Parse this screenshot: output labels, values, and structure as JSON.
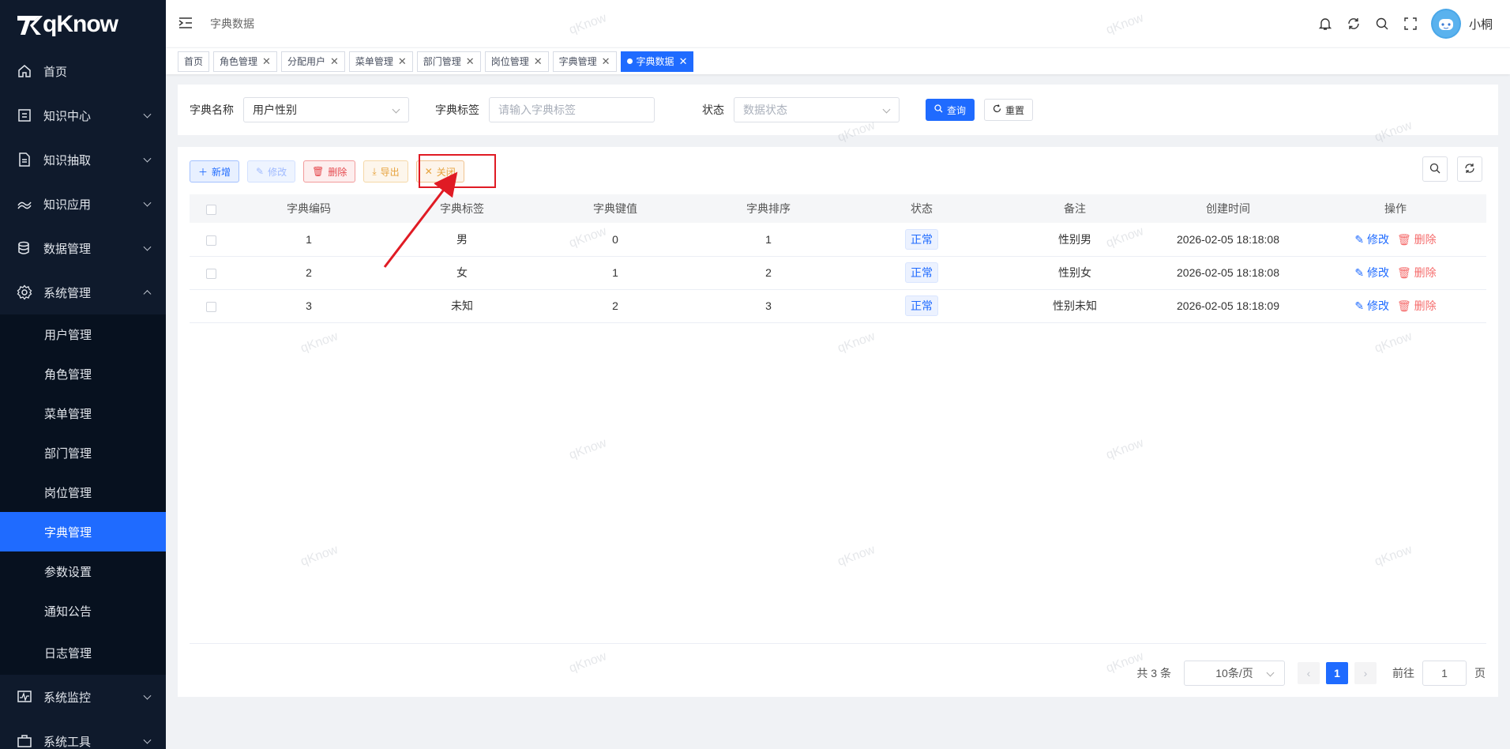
{
  "logo": {
    "text": "qKnow"
  },
  "sidebar": {
    "items": [
      {
        "label": "首页",
        "icon": "home-icon"
      },
      {
        "label": "知识中心",
        "icon": "book-icon"
      },
      {
        "label": "知识抽取",
        "icon": "document-icon"
      },
      {
        "label": "知识应用",
        "icon": "app-icon"
      },
      {
        "label": "数据管理",
        "icon": "database-icon"
      },
      {
        "label": "系统管理",
        "icon": "gear-icon"
      }
    ],
    "sub_items": [
      {
        "label": "用户管理"
      },
      {
        "label": "角色管理"
      },
      {
        "label": "菜单管理"
      },
      {
        "label": "部门管理"
      },
      {
        "label": "岗位管理"
      },
      {
        "label": "字典管理"
      },
      {
        "label": "参数设置"
      },
      {
        "label": "通知公告"
      },
      {
        "label": "日志管理"
      }
    ],
    "bottom_items": [
      {
        "label": "系统监控"
      },
      {
        "label": "系统工具"
      }
    ]
  },
  "navbar": {
    "breadcrumb": "字典数据",
    "username": "小桐"
  },
  "tags": [
    {
      "label": "首页"
    },
    {
      "label": "角色管理"
    },
    {
      "label": "分配用户"
    },
    {
      "label": "菜单管理"
    },
    {
      "label": "部门管理"
    },
    {
      "label": "岗位管理"
    },
    {
      "label": "字典管理"
    },
    {
      "label": "字典数据"
    }
  ],
  "search": {
    "dict_name_label": "字典名称",
    "dict_name_value": "用户性别",
    "dict_label_label": "字典标签",
    "dict_label_placeholder": "请输入字典标签",
    "status_label": "状态",
    "status_placeholder": "数据状态",
    "query_label": "查询",
    "reset_label": "重置"
  },
  "toolbar": {
    "add_label": "新增",
    "edit_label": "修改",
    "delete_label": "删除",
    "export_label": "导出",
    "close_label": "关闭"
  },
  "table": {
    "headers": [
      "字典编码",
      "字典标签",
      "字典键值",
      "字典排序",
      "状态",
      "备注",
      "创建时间",
      "操作"
    ],
    "rows": [
      {
        "code": "1",
        "label": "男",
        "value": "0",
        "sort": "1",
        "status": "正常",
        "remark": "性别男",
        "time": "2026-02-05 18:18:08"
      },
      {
        "code": "2",
        "label": "女",
        "value": "1",
        "sort": "2",
        "status": "正常",
        "remark": "性别女",
        "time": "2026-02-05 18:18:08"
      },
      {
        "code": "3",
        "label": "未知",
        "value": "2",
        "sort": "3",
        "status": "正常",
        "remark": "性别未知",
        "time": "2026-02-05 18:18:09"
      }
    ],
    "edit_op": "修改",
    "delete_op": "删除"
  },
  "pager": {
    "total": "共 3 条",
    "page_size": "10条/页",
    "current_page": "1",
    "goto_label": "前往",
    "goto_value": "1",
    "page_unit": "页"
  },
  "watermark": "qKnow",
  "colors": {
    "primary": "#1f6bff",
    "sidebar_bg": "#0f1a2c",
    "highlight": "#e01b24"
  }
}
